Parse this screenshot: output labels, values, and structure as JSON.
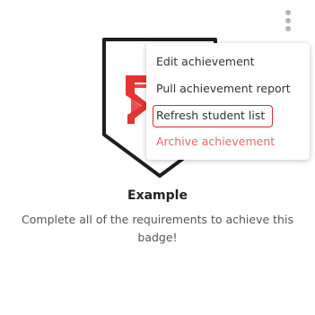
{
  "badge": {
    "name": "Example",
    "description": "Complete all of the requirements to achieve this badge!",
    "accent_color": "#e3342f",
    "outline_color": "#1e1e1e"
  },
  "card_menu": {
    "trigger_icon": "kebab-vertical-icon",
    "items": [
      {
        "label": "Edit achievement"
      },
      {
        "label": "Pull achievement report"
      },
      {
        "label": "Refresh student list"
      },
      {
        "label": "Archive achievement"
      }
    ],
    "danger_color": "#e26a6a",
    "highlight_color": "#d92a2a"
  }
}
